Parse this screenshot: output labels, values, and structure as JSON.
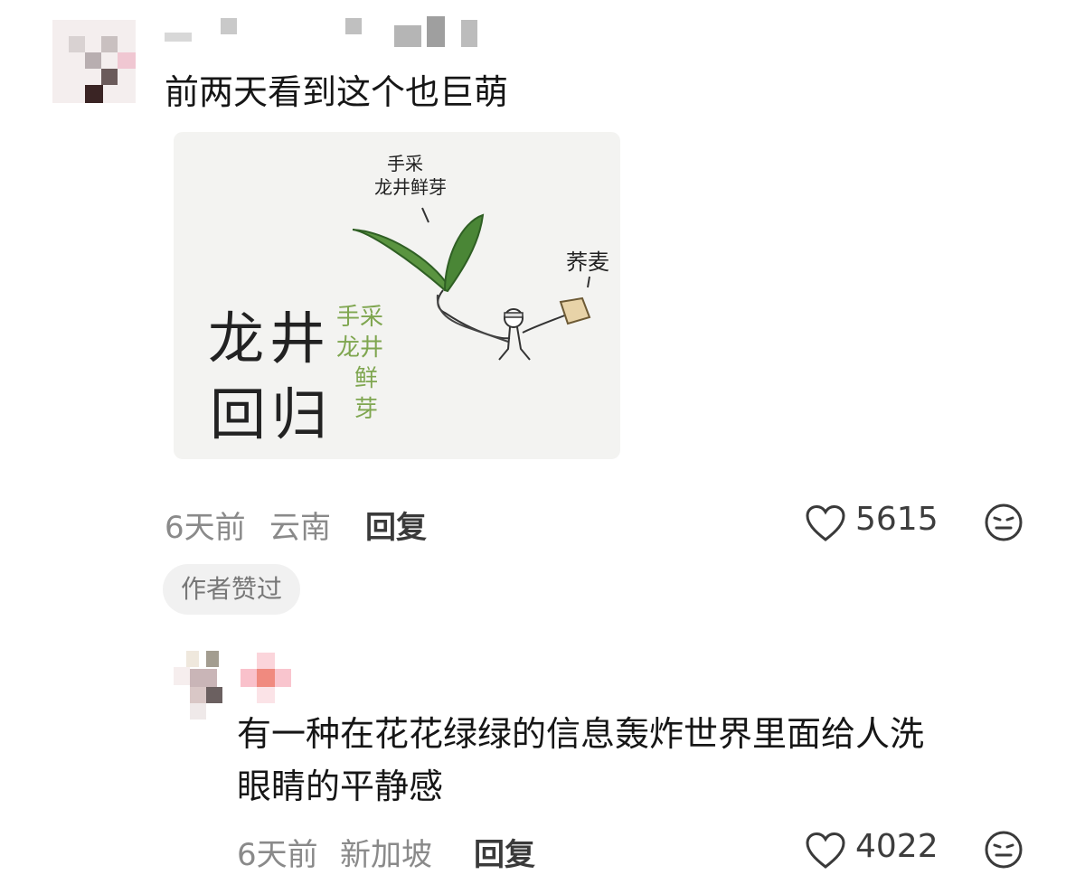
{
  "comment1": {
    "text": "前两天看到这个也巨萌",
    "image": {
      "main_title_line1": "龙井",
      "main_title_line2": "回归",
      "side_vertical": [
        "手采",
        "龙井",
        "鲜",
        "芽"
      ],
      "leaf_caption_line1": "手采",
      "leaf_caption_line2": "龙井鲜芽",
      "figure_caption": "荞麦"
    },
    "time": "6天前",
    "location": "云南",
    "reply_label": "回复",
    "likes": "5615",
    "badge": "作者赞过"
  },
  "comment2": {
    "text_line1": "有一种在花花绿绿的信息轰炸世界里面给人洗",
    "text_line2": "眼睛的平静感",
    "time": "6天前",
    "location": "新加坡",
    "reply_label": "回复",
    "likes": "4022"
  },
  "colors": {
    "leaf": "#4f8a3a",
    "leaf_dark": "#2f5f24",
    "green_text": "#7fa650",
    "meta_gray": "#8a8a8a"
  }
}
